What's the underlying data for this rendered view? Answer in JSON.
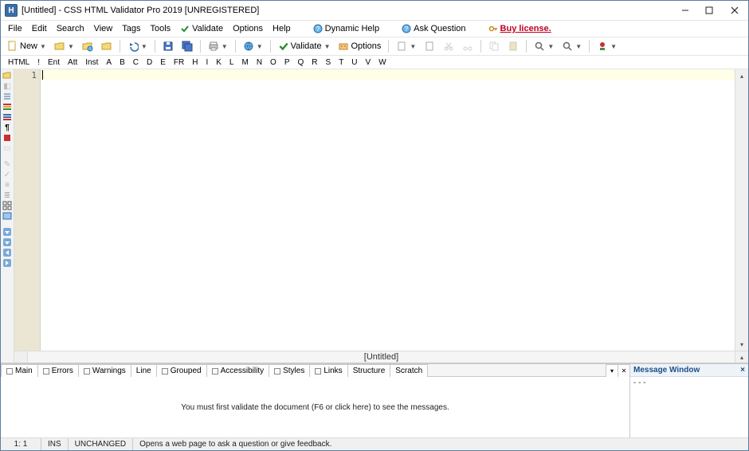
{
  "titlebar": {
    "app_icon_letter": "H",
    "title": "[Untitled] - CSS HTML Validator Pro 2019 [UNREGISTERED]"
  },
  "menubar": {
    "items": [
      "File",
      "Edit",
      "Search",
      "View",
      "Tags",
      "Tools",
      "Validate",
      "Options",
      "Help"
    ],
    "dynamic_help": "Dynamic Help",
    "ask_question": "Ask Question",
    "buy_license": "Buy license."
  },
  "toolbar": {
    "new_label": "New",
    "validate_label": "Validate",
    "options_label": "Options"
  },
  "tagbar": {
    "tags": [
      "HTML",
      "!",
      "Ent",
      "Att",
      "Inst",
      "A",
      "B",
      "C",
      "D",
      "E",
      "FR",
      "H",
      "I",
      "K",
      "L",
      "M",
      "N",
      "O",
      "P",
      "Q",
      "R",
      "S",
      "T",
      "U",
      "V",
      "W"
    ]
  },
  "editor": {
    "line_number": "1"
  },
  "doc_tab": {
    "label": "[Untitled]"
  },
  "bottom_tabs": {
    "items": [
      "Main",
      "Errors",
      "Warnings",
      "Line",
      "Grouped",
      "Accessibility",
      "Styles",
      "Links",
      "Structure",
      "Scratch"
    ],
    "message": "You must first validate the document (F6 or click here) to see the messages."
  },
  "message_window": {
    "title": "Message Window",
    "content": "- - -"
  },
  "statusbar": {
    "pos": "1: 1",
    "ins": "INS",
    "changed": "UNCHANGED",
    "hint": "Opens a web page to ask a question or give feedback."
  }
}
